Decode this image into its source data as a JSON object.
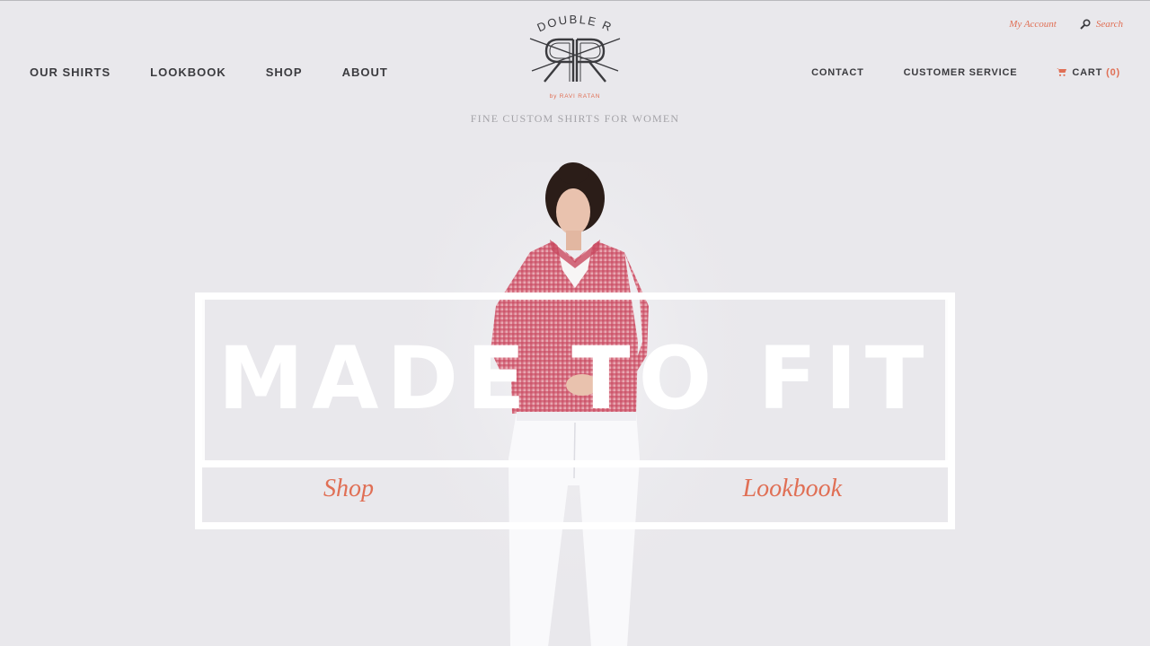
{
  "nav_left": [
    {
      "label": "OUR SHIRTS"
    },
    {
      "label": "LOOKBOOK"
    },
    {
      "label": "SHOP"
    },
    {
      "label": "ABOUT"
    }
  ],
  "nav_right": {
    "contact": "CONTACT",
    "customer_service": "CUSTOMER SERVICE",
    "cart_label": "CART",
    "cart_count": "(0)"
  },
  "utility": {
    "account": "My Account",
    "search": "Search"
  },
  "logo": {
    "name": "DOUBLE R",
    "byline": "by RAVI RATAN"
  },
  "tagline": "FINE CUSTOM SHIRTS FOR WOMEN",
  "hero": {
    "title": "MADE TO FIT",
    "shop": "Shop",
    "lookbook": "Lookbook"
  },
  "colors": {
    "background": "#e9e8ec",
    "accent": "#e06f55",
    "nav_text": "#3b3b3f",
    "shirt": "#c8485f"
  }
}
